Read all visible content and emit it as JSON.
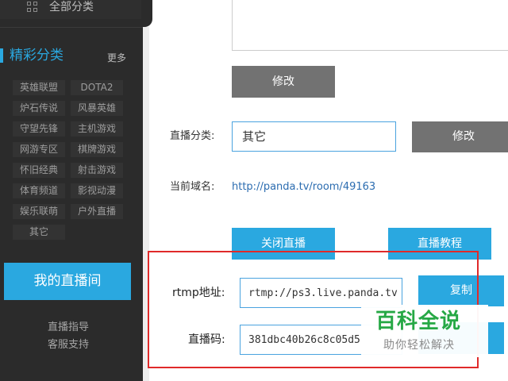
{
  "sidebar": {
    "all_categories": "全部分类",
    "featured_title": "精彩分类",
    "more": "更多",
    "tags": [
      "英雄联盟",
      "DOTA2",
      "炉石传说",
      "风暴英雄",
      "守望先锋",
      "主机游戏",
      "网游专区",
      "棋牌游戏",
      "怀旧经典",
      "射击游戏",
      "体育频道",
      "影视动漫",
      "娱乐联萌",
      "户外直播",
      "其它"
    ],
    "my_live_room": "我的直播间",
    "live_guide": "直播指导",
    "customer_support": "客服支持"
  },
  "main": {
    "modify_label_1": "修改",
    "category_label": "直播分类:",
    "category_value": "其它",
    "modify_label_2": "修改",
    "domain_label": "当前域名:",
    "domain_url": "http://panda.tv/room/49163",
    "close_live": "关闭直播",
    "live_tutorial": "直播教程",
    "rtmp_label": "rtmp地址:",
    "rtmp_value": "rtmp://ps3.live.panda.tv",
    "copy": "复制",
    "code_label": "直播码:",
    "code_value": "381dbc40b26c8c05d5"
  },
  "watermark": {
    "title": "百科全说",
    "subtitle": "助你轻松解决"
  },
  "colors": {
    "accent": "#2aa8e0",
    "sidebar_bg": "#2b2b2b",
    "highlight_frame": "#e02a2a",
    "watermark_green": "#26a845"
  }
}
